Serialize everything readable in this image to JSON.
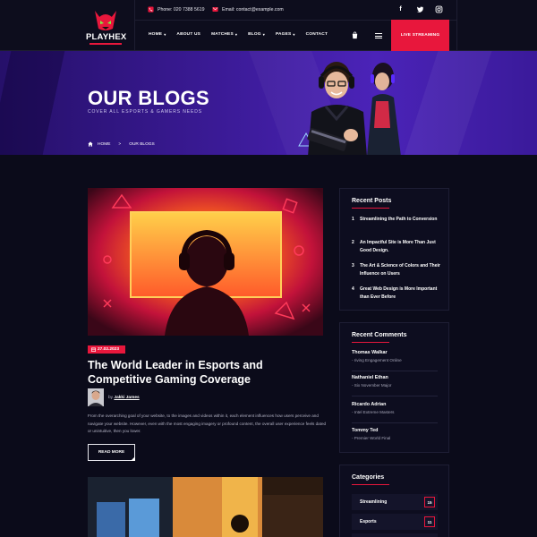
{
  "brand": {
    "name": "PLAYHEX"
  },
  "topbar": {
    "phone": "Phone: 020 7388 5619",
    "email": "Email: contact@example.com",
    "social": [
      "facebook-icon",
      "twitter-icon",
      "instagram-icon"
    ]
  },
  "nav": {
    "items": [
      {
        "label": "HOME",
        "has_dropdown": true
      },
      {
        "label": "ABOUT US",
        "has_dropdown": false
      },
      {
        "label": "MATCHES",
        "has_dropdown": true
      },
      {
        "label": "BLOG",
        "has_dropdown": true
      },
      {
        "label": "PAGES",
        "has_dropdown": true
      },
      {
        "label": "CONTACT",
        "has_dropdown": false
      }
    ],
    "cta": "LIVE STREAMING"
  },
  "hero": {
    "title": "OUR BLOGS",
    "subtitle": "COVER ALL ESPORTS & GAMERS NEEDS",
    "breadcrumb": {
      "home": "HOME",
      "separator": ">",
      "current": "OUR BLOGS"
    }
  },
  "post": {
    "date": "27.02.2023",
    "title": "The World Leader in Esports and Competitive Gaming Coverage",
    "author_prefix": "by",
    "author": "Jakki James",
    "excerpt": "From the overarching goal of your website, to the images and videos within it, each element influences how users perceive and navigate your website. However, even with the most engaging imagery or profound content, the overall user experience feels dated or unintuitive, then you lower.",
    "read_more": "READ MORE"
  },
  "sidebar": {
    "recent_posts": {
      "title": "Recent Posts",
      "items": [
        {
          "num": "1",
          "title": "Streamlining the Path to Conversion"
        },
        {
          "num": "2",
          "title": "An Impactful Site is More Than Just Good Design."
        },
        {
          "num": "3",
          "title": "The Art & Science of Colors and Their Influence on Users"
        },
        {
          "num": "4",
          "title": "Great Web Design is More Important than Ever Before"
        }
      ]
    },
    "recent_comments": {
      "title": "Recent Comments",
      "items": [
        {
          "name": "Thomas Walkar",
          "sub": "- riving Engagement Online"
        },
        {
          "name": "Nathaniel Ethan",
          "sub": "- Six November Major"
        },
        {
          "name": "Ricardo Adrian",
          "sub": "- Intel Extreme Masters"
        },
        {
          "name": "Tommy Ted",
          "sub": "- Premier World Final"
        }
      ]
    },
    "categories": {
      "title": "Categories",
      "items": [
        {
          "name": "Streamlining",
          "count": "15"
        },
        {
          "name": "Esports",
          "count": "11"
        }
      ]
    }
  },
  "colors": {
    "accent": "#e8173c",
    "background": "#0b0b1a",
    "hero": "#3a1a95"
  }
}
